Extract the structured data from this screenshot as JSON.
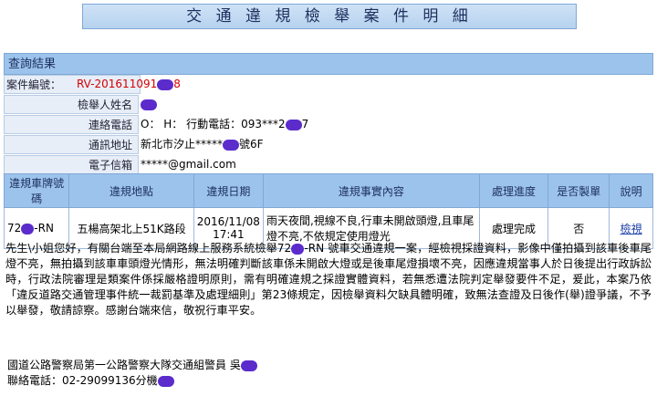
{
  "title": "交 通 違 規 檢 舉 案 件 明 細",
  "section_header": "查詢結果",
  "info_rows": [
    {
      "label": "案件編號：",
      "value": "RV-201611091",
      "value_tail": "8"
    },
    {
      "label": "檢舉人姓名",
      "value": ""
    },
    {
      "label": "連絡電話",
      "value": "O：  H：  行動電話：093***2",
      "value_tail": "7"
    },
    {
      "label": "通訊地址",
      "value": "新北市汐止*****",
      "value_tail": "號6F"
    },
    {
      "label": "電子信箱",
      "value": "*****@gmail.com"
    }
  ],
  "table": {
    "headers": [
      "違規車牌號碼",
      "違規地點",
      "違規日期",
      "違規事實內容",
      "處理進度",
      "是否製單",
      "說明"
    ],
    "row": {
      "plate_prefix": "72",
      "plate_suffix": "-RN",
      "location": "五楊高架北上51K路段",
      "date": "2016/11/08",
      "time": "17:41",
      "fact": "雨天夜間,視線不良,行車未開啟頭燈,且車尾燈不亮,不依規定使用燈光",
      "status": "處理完成",
      "ticket": "否",
      "detail_link": "檢視"
    }
  },
  "message": {
    "part1": "先生\\小姐您好，有關台端至本局網路線上服務系統檢舉72",
    "part2": "-RN 號車交通違規一案，經檢視採證資料，影像中僅拍攝到該車後車尾燈不亮，無拍攝到該車車頭燈光情形，無法明確判斷該車係未開啟大燈或是後車尾燈損壞不亮，因應違規當事人於日後提出行政訴訟時，行政法院審理是類案件係採嚴格證明原則，需有明確違規之採證實體資料，若無悉遭法院判定舉發要件不足，爰此，本案乃依「違反道路交通管理事件統一裁罰基準及處理細則」第23條規定，因檢舉資料欠缺具體明確，致無法查證及日後作(舉)證爭議，不予以舉發，敬請諒察。感謝台端來信，敬祝行車平安。"
  },
  "footer": {
    "officer": "國道公路警察局第一公路警察大隊交通組警員 吳",
    "phone": "聯絡電話：02-29099136分機"
  },
  "colors": {
    "header_blue": "#9cc3ec",
    "label_bg": "#e7eef8",
    "case_red": "#d40000",
    "redaction": "#5b2bcc"
  }
}
